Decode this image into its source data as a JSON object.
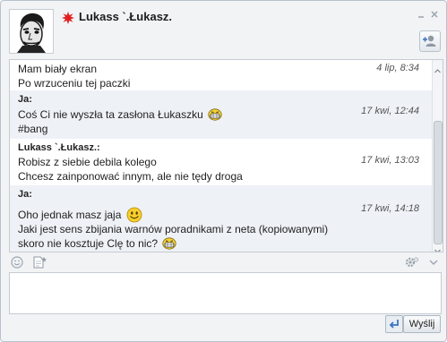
{
  "header": {
    "contact_name": "Lukass `.Łukasz."
  },
  "colors": {
    "status": "#e02020",
    "own_message_bg": "#eef1f6",
    "accent": "#3a74c4"
  },
  "icons": {
    "status": "busy-star-icon",
    "add_contact": "add-person-icon",
    "emoticon": "smiley-icon",
    "file": "file-send-icon",
    "settings": "gear-icon",
    "enter": "enter-key-icon"
  },
  "messages": [
    {
      "sender": "",
      "own": false,
      "time": "4 lip, 8:34",
      "lines": [
        "Mam biały ekran",
        "Po wrzuceniu tej paczki"
      ]
    },
    {
      "sender": "Ja:",
      "own": true,
      "time": "17 kwi, 12:44",
      "lines": [
        "Coś Ci nie wyszła ta zasłona Łukaszku",
        "#bang"
      ]
    },
    {
      "sender": "Lukass `.Łukasz.:",
      "own": false,
      "time": "17 kwi, 13:03",
      "lines": [
        "Robisz z siebie debila kolego",
        "Chcesz zainponować innym, ale nie tędy droga"
      ]
    },
    {
      "sender": "Ja:",
      "own": true,
      "time": "17 kwi, 14:18",
      "lines": [
        "Oho jednak masz jaja",
        "Jaki jest sens zbijania warnów poradnikami z neta (kopiowanymi)",
        "skoro nie kosztuje Clę to nic?"
      ]
    }
  ],
  "composer": {
    "send_label": "Wyślij"
  }
}
